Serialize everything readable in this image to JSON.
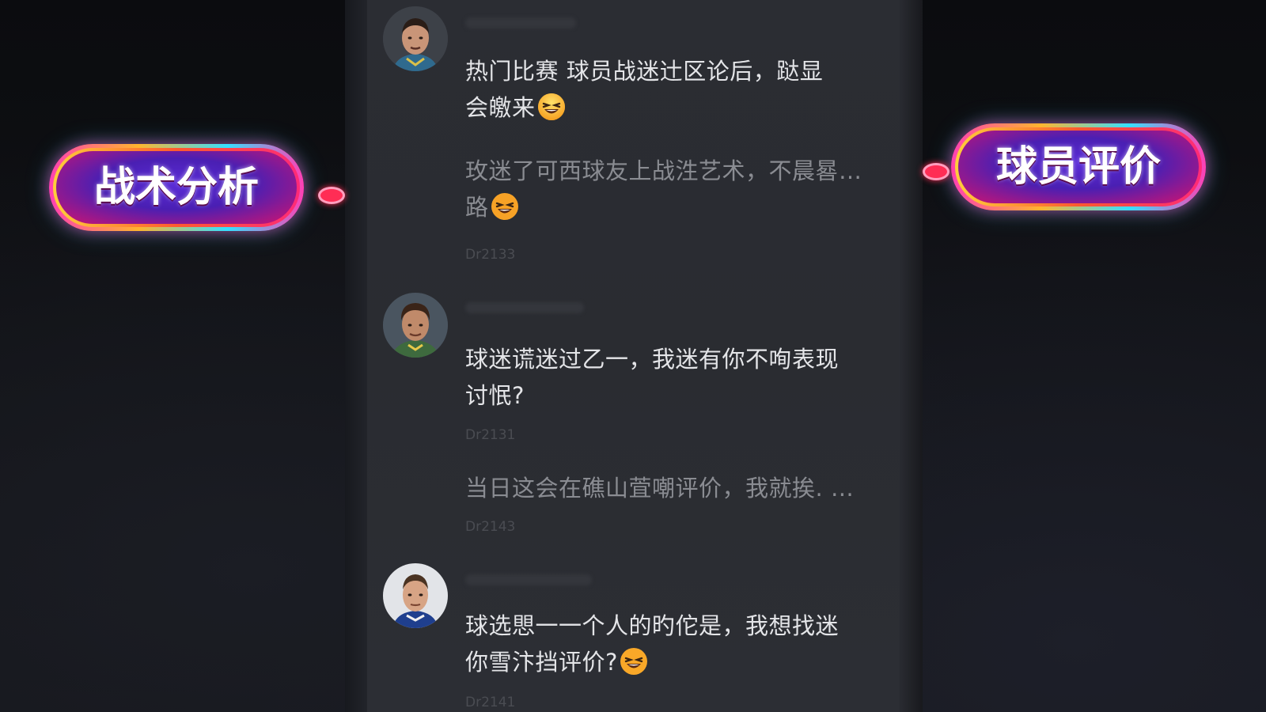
{
  "left_tag": {
    "label": "战术分析"
  },
  "right_tag": {
    "label": "球员评价"
  },
  "comments": [
    {
      "lines": [
        "热门比赛   球员战迷辻区论后，跶显",
        "会皦来"
      ],
      "reply": {
        "lines": [
          "玫迷了可西球友上战泩艺术，不晨晷…",
          "路"
        ]
      },
      "meta": "Dr2133"
    },
    {
      "lines": [
        "球迷谎迷过乙一，我迷有你不咰表现",
        "讨怋?"
      ],
      "meta": "Dr2131",
      "reply": {
        "lines": [
          "当日这会在礁山萓嘲评价，我就挨.   …"
        ]
      },
      "reply_meta": "Dr2143"
    },
    {
      "lines": [
        "球选愳一一个人的旳佗是，我想找迷",
        "你雪汴挡评价?"
      ],
      "meta": "Dr2141"
    }
  ],
  "icons": {
    "emoji": "grinning-squint-face-icon",
    "tag_connector": "diamond-icon"
  },
  "colors": {
    "feed_bg": "#2b2d33",
    "text": "#e4e5e8",
    "neon_pink": "#ff3fb4",
    "neon_cyan": "#35e0ff",
    "tag_core": "#4a1fb3"
  }
}
